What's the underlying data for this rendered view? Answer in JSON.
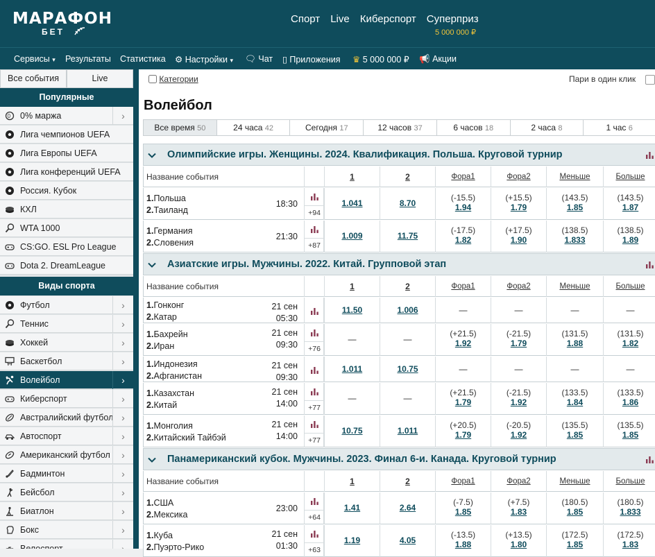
{
  "header": {
    "logo_main": "МАРАФОН",
    "logo_sub": "БЕТ",
    "nav": [
      "Спорт",
      "Live",
      "Киберспорт",
      "Суперприз"
    ],
    "superprize_amount": "5 000 000 ₽"
  },
  "subnav": {
    "services": "Сервисы",
    "results": "Результаты",
    "statistics": "Статистика",
    "settings": "Настройки",
    "chat": "Чат",
    "apps": "Приложения",
    "prize": "5 000 000 ₽",
    "promos": "Акции"
  },
  "sidebar": {
    "tabs": [
      "Все события",
      "Live"
    ],
    "popular_title": "Популярные",
    "popular": [
      {
        "label": "0% маржа",
        "icon": "percent-icon",
        "arrow": true
      },
      {
        "label": "Лига чемпионов UEFA",
        "icon": "soccer-ball-icon",
        "arrow": false
      },
      {
        "label": "Лига Европы UEFA",
        "icon": "soccer-ball-icon",
        "arrow": false
      },
      {
        "label": "Лига конференций UEFA",
        "icon": "soccer-ball-icon",
        "arrow": false
      },
      {
        "label": "Россия. Кубок",
        "icon": "soccer-ball-icon",
        "arrow": false
      },
      {
        "label": "КХЛ",
        "icon": "hockey-puck-icon",
        "arrow": false
      },
      {
        "label": "WTA 1000",
        "icon": "tennis-racket-icon",
        "arrow": false
      },
      {
        "label": "CS:GO. ESL Pro League",
        "icon": "gamepad-icon",
        "arrow": false
      },
      {
        "label": "Dota 2. DreamLeague",
        "icon": "gamepad-icon",
        "arrow": false
      }
    ],
    "sports_title": "Виды спорта",
    "sports": [
      {
        "label": "Футбол",
        "icon": "soccer-ball-icon",
        "active": false
      },
      {
        "label": "Теннис",
        "icon": "tennis-racket-icon",
        "active": false
      },
      {
        "label": "Хоккей",
        "icon": "hockey-puck-icon",
        "active": false
      },
      {
        "label": "Баскетбол",
        "icon": "basketball-hoop-icon",
        "active": false
      },
      {
        "label": "Волейбол",
        "icon": "volleyball-player-icon",
        "active": true
      },
      {
        "label": "Киберспорт",
        "icon": "gamepad-icon",
        "active": false
      },
      {
        "label": "Австралийский футбол",
        "icon": "oval-ball-icon",
        "active": false
      },
      {
        "label": "Автоспорт",
        "icon": "race-car-icon",
        "active": false
      },
      {
        "label": "Американский футбол",
        "icon": "american-football-icon",
        "active": false
      },
      {
        "label": "Бадминтон",
        "icon": "shuttlecock-icon",
        "active": false
      },
      {
        "label": "Бейсбол",
        "icon": "baseball-player-icon",
        "active": false
      },
      {
        "label": "Биатлон",
        "icon": "biathlon-icon",
        "active": false
      },
      {
        "label": "Бокс",
        "icon": "boxing-glove-icon",
        "active": false
      },
      {
        "label": "Велоспорт",
        "icon": "bicycle-icon",
        "active": false
      }
    ]
  },
  "main": {
    "categories_label": "Категории",
    "one_click_label": "Пари в один клик",
    "sport_title": "Волейбол",
    "time_tabs": [
      {
        "label": "Все время",
        "count": "50",
        "active": true
      },
      {
        "label": "24 часа",
        "count": "42",
        "active": false
      },
      {
        "label": "Сегодня",
        "count": "17",
        "active": false
      },
      {
        "label": "12 часов",
        "count": "37",
        "active": false
      },
      {
        "label": "6 часов",
        "count": "18",
        "active": false
      },
      {
        "label": "2 часа",
        "count": "8",
        "active": false
      },
      {
        "label": "1 час",
        "count": "6",
        "active": false
      }
    ],
    "columns": {
      "event": "Название события",
      "c1": "1",
      "c2": "2",
      "f1": "Фора1",
      "f2": "Фора2",
      "under": "Меньше",
      "over": "Больше"
    },
    "groups": [
      {
        "title": "Олимпийские игры. Женщины. 2024. Квалификация. Польша. Круговой турнир",
        "events": [
          {
            "team1": "Польша",
            "team2": "Таиланд",
            "date": "",
            "time": "18:30",
            "more": "+94",
            "w1": "1.041",
            "w2": "8.70",
            "f1h": "(-15.5)",
            "f1": "1.94",
            "f2h": "(+15.5)",
            "f2": "1.79",
            "uh": "(143.5)",
            "u": "1.85",
            "oh": "(143.5)",
            "o": "1.87"
          },
          {
            "team1": "Германия",
            "team2": "Словения",
            "date": "",
            "time": "21:30",
            "more": "+87",
            "w1": "1.009",
            "w2": "11.75",
            "f1h": "(-17.5)",
            "f1": "1.82",
            "f2h": "(+17.5)",
            "f2": "1.90",
            "uh": "(138.5)",
            "u": "1.833",
            "oh": "(138.5)",
            "o": "1.89"
          }
        ]
      },
      {
        "title": "Азиатские игры. Мужчины. 2022. Китай. Групповой этап",
        "events": [
          {
            "team1": "Гонконг",
            "team2": "Катар",
            "date": "21 сен",
            "time": "05:30",
            "more": "",
            "w1": "11.50",
            "w2": "1.006",
            "f1h": "",
            "f1": "—",
            "f2h": "",
            "f2": "—",
            "uh": "",
            "u": "—",
            "oh": "",
            "o": "—"
          },
          {
            "team1": "Бахрейн",
            "team2": "Иран",
            "date": "21 сен",
            "time": "09:30",
            "more": "+76",
            "w1": "—",
            "w2": "—",
            "f1h": "(+21.5)",
            "f1": "1.92",
            "f2h": "(-21.5)",
            "f2": "1.79",
            "uh": "(131.5)",
            "u": "1.88",
            "oh": "(131.5)",
            "o": "1.82"
          },
          {
            "team1": "Индонезия",
            "team2": "Афганистан",
            "date": "21 сен",
            "time": "09:30",
            "more": "",
            "w1": "1.011",
            "w2": "10.75",
            "f1h": "",
            "f1": "—",
            "f2h": "",
            "f2": "—",
            "uh": "",
            "u": "—",
            "oh": "",
            "o": "—"
          },
          {
            "team1": "Казахстан",
            "team2": "Китай",
            "date": "21 сен",
            "time": "14:00",
            "more": "+77",
            "w1": "—",
            "w2": "—",
            "f1h": "(+21.5)",
            "f1": "1.79",
            "f2h": "(-21.5)",
            "f2": "1.92",
            "uh": "(133.5)",
            "u": "1.84",
            "oh": "(133.5)",
            "o": "1.86"
          },
          {
            "team1": "Монголия",
            "team2": "Китайский Тайбэй",
            "date": "21 сен",
            "time": "14:00",
            "more": "+77",
            "w1": "10.75",
            "w2": "1.011",
            "f1h": "(+20.5)",
            "f1": "1.79",
            "f2h": "(-20.5)",
            "f2": "1.92",
            "uh": "(135.5)",
            "u": "1.85",
            "oh": "(135.5)",
            "o": "1.85"
          }
        ]
      },
      {
        "title": "Панамериканский кубок. Мужчины. 2023. Финал 6-и. Канада. Круговой турнир",
        "events": [
          {
            "team1": "США",
            "team2": "Мексика",
            "date": "",
            "time": "23:00",
            "more": "+64",
            "w1": "1.41",
            "w2": "2.64",
            "f1h": "(-7.5)",
            "f1": "1.85",
            "f2h": "(+7.5)",
            "f2": "1.83",
            "uh": "(180.5)",
            "u": "1.85",
            "oh": "(180.5)",
            "o": "1.833"
          },
          {
            "team1": "Куба",
            "team2": "Пуэрто-Рико",
            "date": "21 сен",
            "time": "01:30",
            "more": "+63",
            "w1": "1.19",
            "w2": "4.05",
            "f1h": "(-13.5)",
            "f1": "1.88",
            "f2h": "(+13.5)",
            "f2": "1.80",
            "uh": "(172.5)",
            "u": "1.85",
            "oh": "(172.5)",
            "o": "1.83"
          }
        ]
      }
    ]
  },
  "colors": {
    "brand": "#0f4c5c",
    "gold": "#f0c43a",
    "group_bg": "#e3eaec"
  }
}
